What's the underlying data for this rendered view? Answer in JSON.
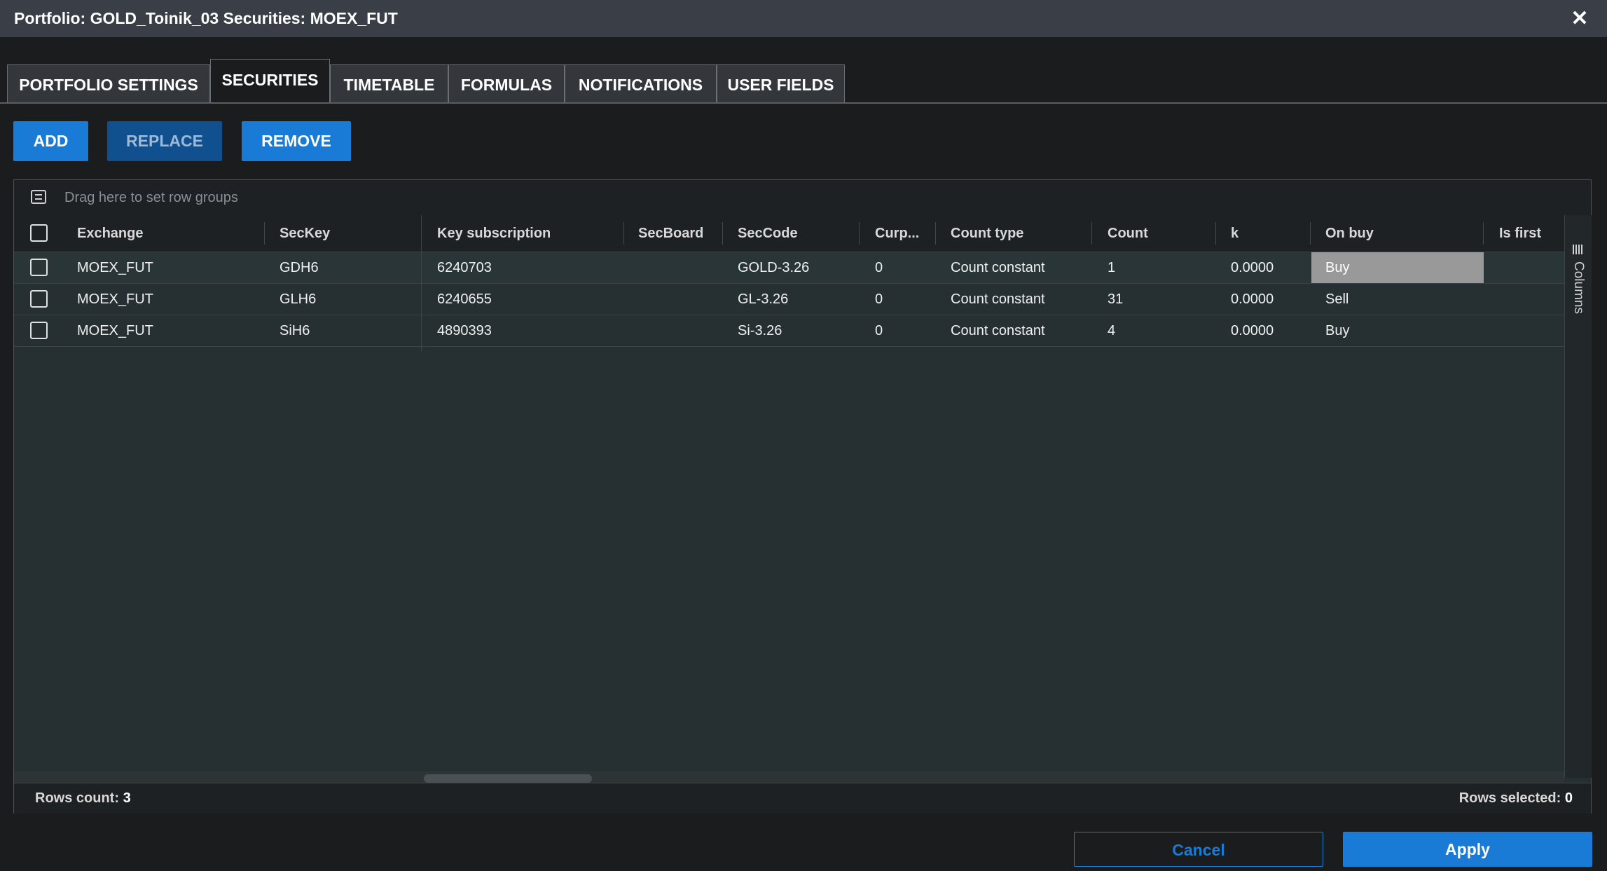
{
  "window": {
    "title": "Portfolio: GOLD_Toinik_03 Securities: MOEX_FUT",
    "close_glyph": "✕"
  },
  "tabs": [
    {
      "label": "PORTFOLIO SETTINGS",
      "active": false
    },
    {
      "label": "SECURITIES",
      "active": true
    },
    {
      "label": "TIMETABLE",
      "active": false
    },
    {
      "label": "FORMULAS",
      "active": false
    },
    {
      "label": "NOTIFICATIONS",
      "active": false
    },
    {
      "label": "USER FIELDS",
      "active": false
    }
  ],
  "toolbar": {
    "add_label": "ADD",
    "replace_label": "REPLACE",
    "remove_label": "REMOVE"
  },
  "grid": {
    "group_hint": "Drag here to set row groups",
    "columns": [
      "Exchange",
      "SecKey",
      "Key subscription",
      "SecBoard",
      "SecCode",
      "Curp...",
      "Count type",
      "Count",
      "k",
      "On buy",
      "Is first"
    ],
    "rows": [
      {
        "exchange": "MOEX_FUT",
        "seckey": "GDH6",
        "key_subscription": "6240703",
        "secboard": "",
        "seccode": "GOLD-3.26",
        "curp": "0",
        "count_type": "Count constant",
        "count": "1",
        "k": "0.0000",
        "on_buy": "Buy"
      },
      {
        "exchange": "MOEX_FUT",
        "seckey": "GLH6",
        "key_subscription": "6240655",
        "secboard": "",
        "seccode": "GL-3.26",
        "curp": "0",
        "count_type": "Count constant",
        "count": "31",
        "k": "0.0000",
        "on_buy": "Sell"
      },
      {
        "exchange": "MOEX_FUT",
        "seckey": "SiH6",
        "key_subscription": "4890393",
        "secboard": "",
        "seccode": "Si-3.26",
        "curp": "0",
        "count_type": "Count constant",
        "count": "4",
        "k": "0.0000",
        "on_buy": "Buy"
      }
    ],
    "side_panel_label": "Columns",
    "status": {
      "rows_count_label": "Rows count:",
      "rows_count_value": "3",
      "rows_selected_label": "Rows selected:",
      "rows_selected_value": "0"
    }
  },
  "footer": {
    "cancel_label": "Cancel",
    "apply_label": "Apply"
  },
  "colors": {
    "accent": "#1a7bd6",
    "titlebar": "#3a3f47",
    "grid_bg": "#263033",
    "highlight_cell": "#999999"
  }
}
